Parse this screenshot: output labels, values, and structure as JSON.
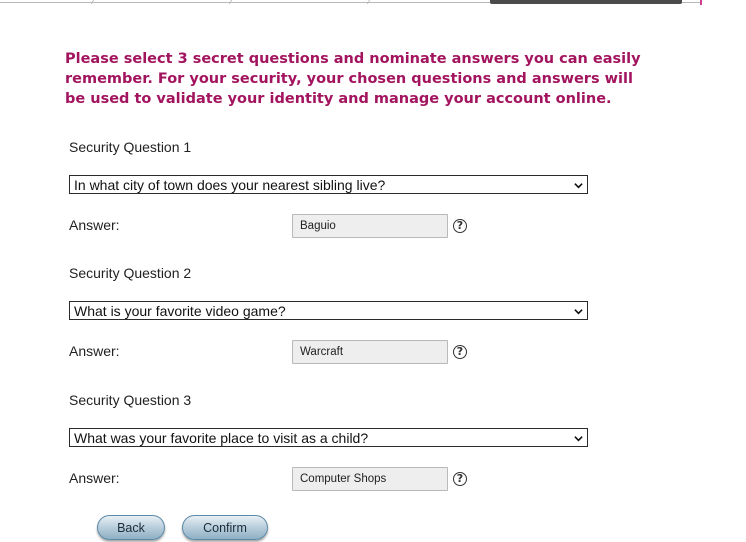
{
  "intro": {
    "text": "Please select 3 secret questions and nominate answers you can easily remember. For your security, your chosen questions and answers will be used to validate your identity and manage your account online."
  },
  "questions": [
    {
      "label": "Security Question 1",
      "selected": "In what city of town does your nearest sibling live?",
      "answer_label": "Answer:",
      "answer_value": "Baguio"
    },
    {
      "label": "Security Question 2",
      "selected": "What is your favorite video game?",
      "answer_label": "Answer:",
      "answer_value": "Warcraft"
    },
    {
      "label": "Security Question 3",
      "selected": "What was your favorite place to visit as a child?",
      "answer_label": "Answer:",
      "answer_value": "Computer Shops"
    }
  ],
  "help_glyph": "?",
  "buttons": {
    "back": "Back",
    "confirm": "Confirm"
  },
  "colors": {
    "intro_text": "#a3145f",
    "button_border": "#5b8aa8"
  }
}
